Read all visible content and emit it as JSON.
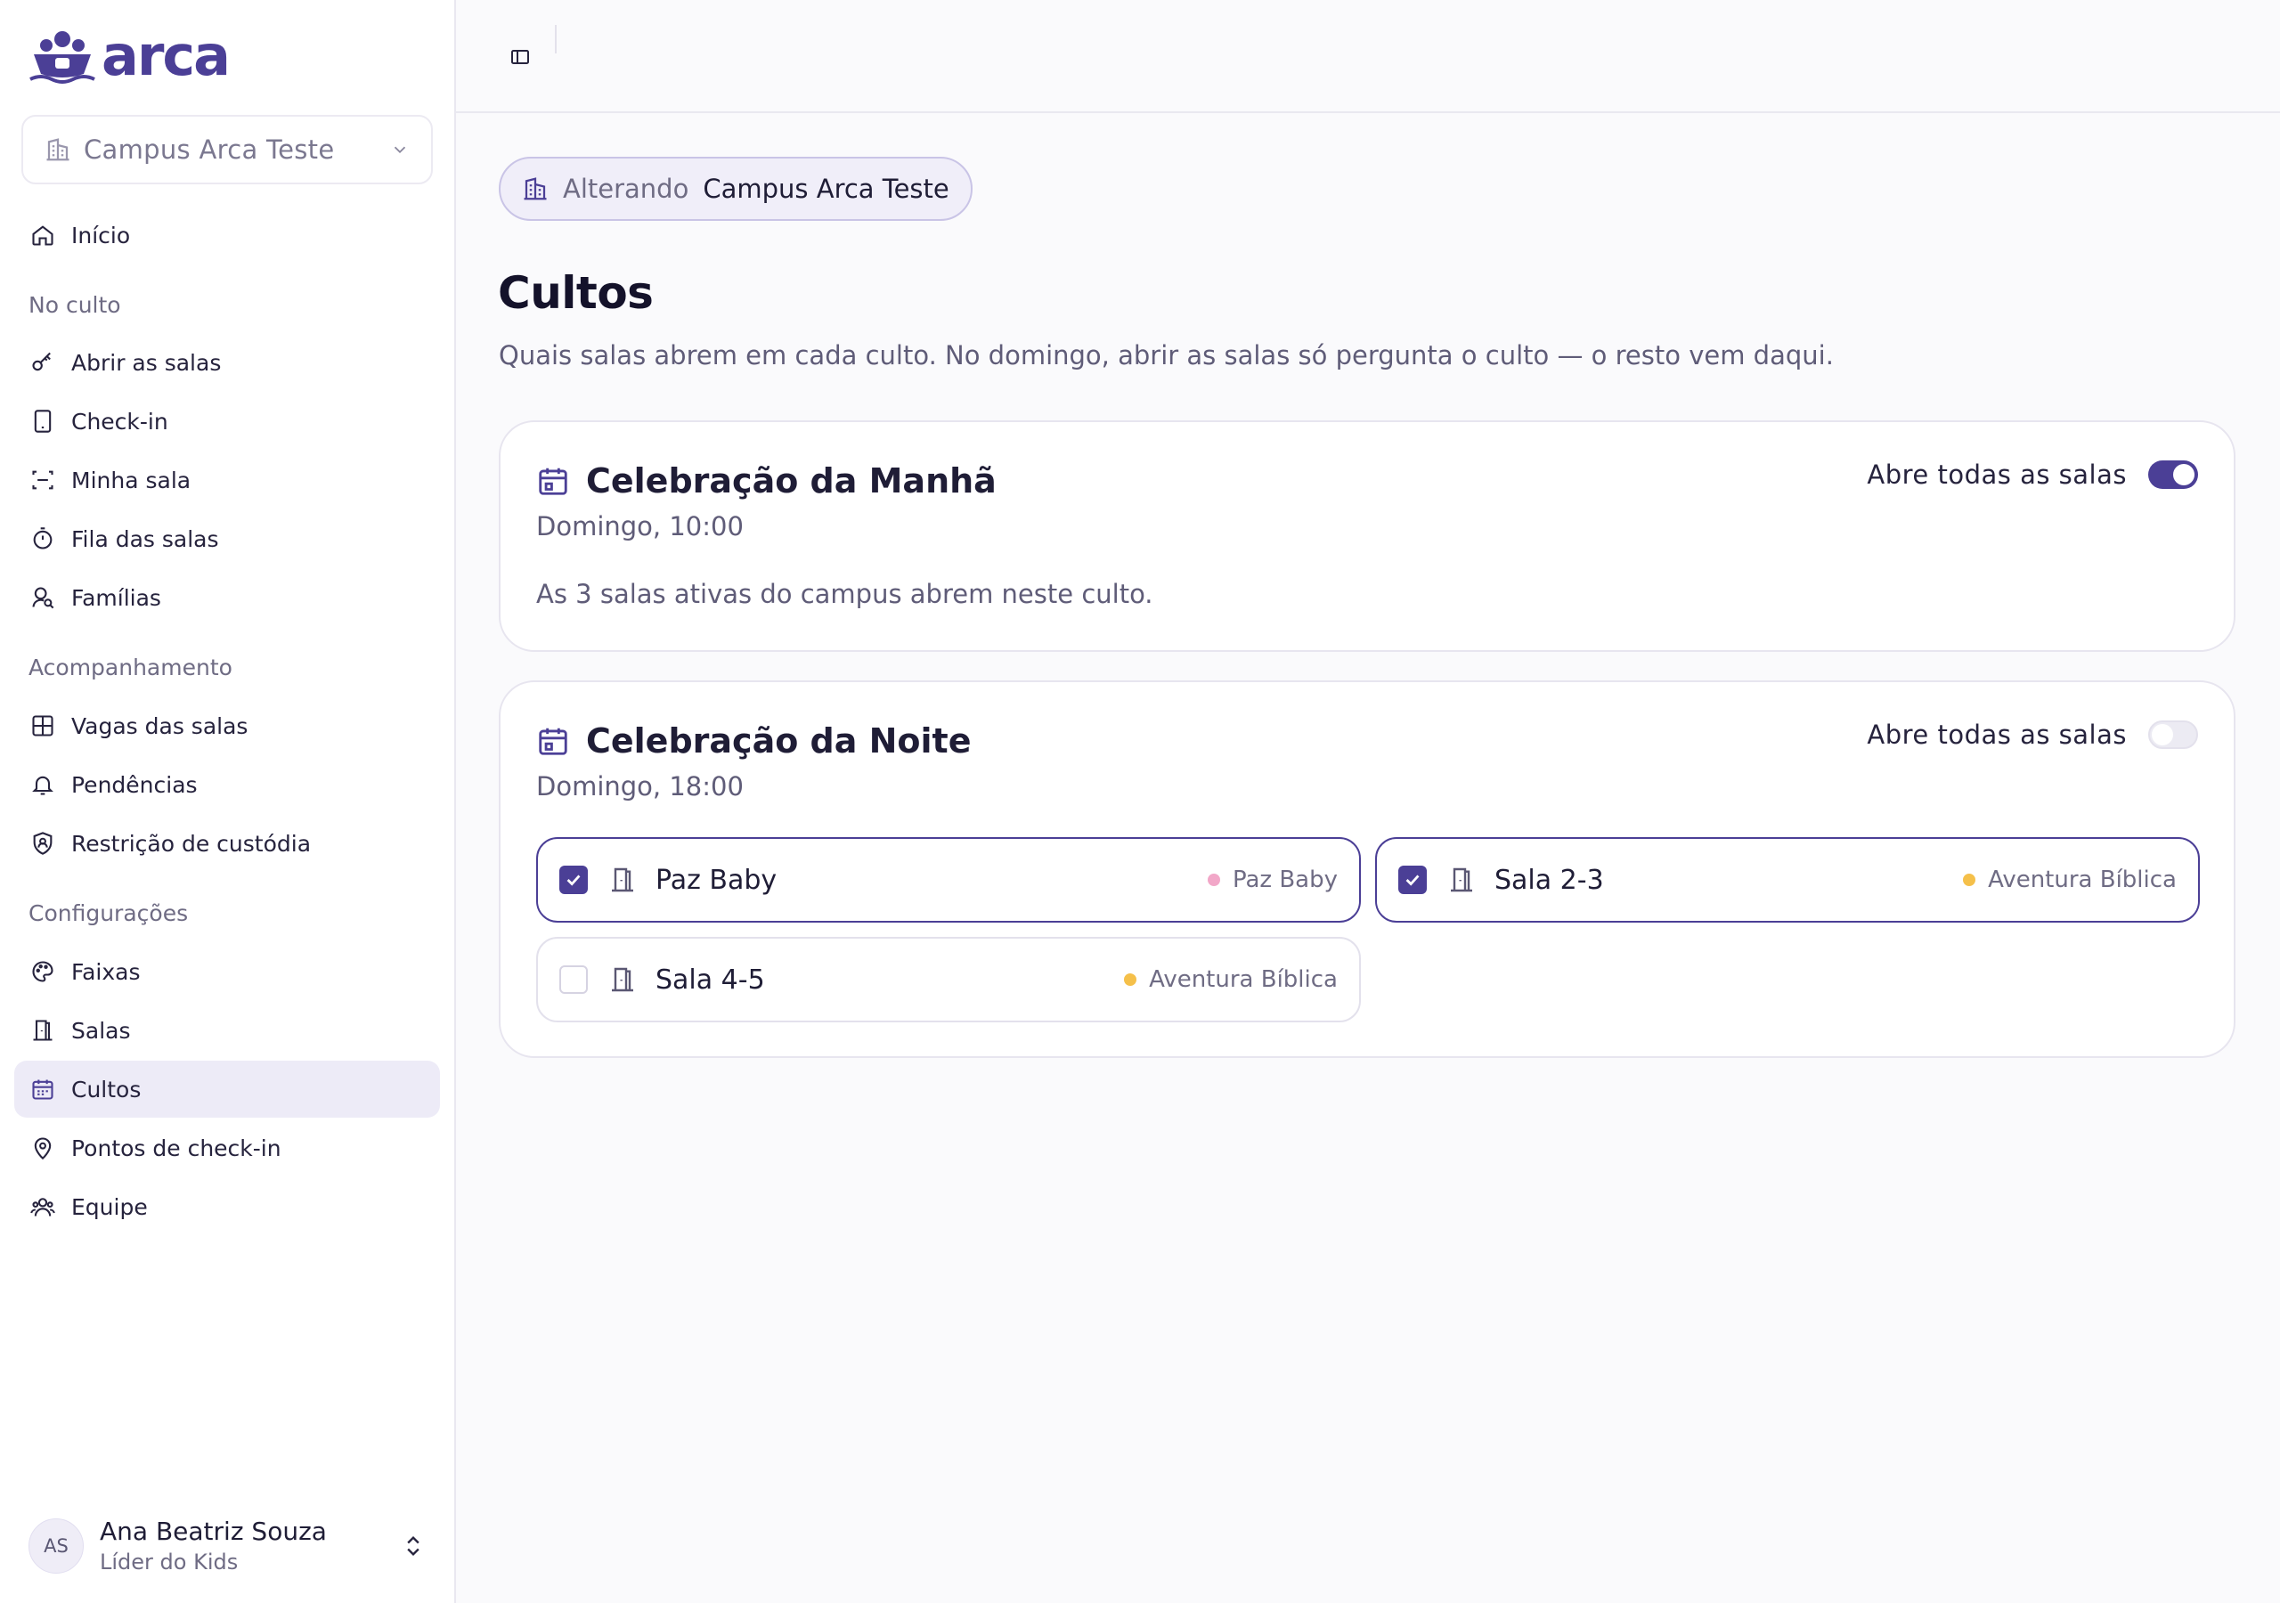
{
  "app": {
    "logo_text": "arca",
    "brand_color": "#4b3f96"
  },
  "sidebar": {
    "campus_select": "Campus Arca Teste",
    "home": "Início",
    "sections": [
      {
        "title": "No culto",
        "items": [
          "Abrir as salas",
          "Check-in",
          "Minha sala",
          "Fila das salas",
          "Famílias"
        ]
      },
      {
        "title": "Acompanhamento",
        "items": [
          "Vagas das salas",
          "Pendências",
          "Restrição de custódia"
        ]
      },
      {
        "title": "Configurações",
        "items": [
          "Faixas",
          "Salas",
          "Cultos",
          "Pontos de check-in",
          "Equipe"
        ]
      }
    ],
    "active_item": "Cultos",
    "user": {
      "initials": "AS",
      "name": "Ana Beatriz Souza",
      "role": "Líder do Kids"
    }
  },
  "main": {
    "chip": {
      "label": "Alterando",
      "value": "Campus Arca Teste"
    },
    "title": "Cultos",
    "description": "Quais salas abrem em cada culto. No domingo, abrir as salas só pergunta o culto — o resto vem daqui.",
    "services": [
      {
        "name": "Celebração da Manhã",
        "schedule": "Domingo, 10:00",
        "opens_all_label": "Abre todas as salas",
        "opens_all": true,
        "note": "As 3 salas ativas do campus abrem neste culto."
      },
      {
        "name": "Celebração da Noite",
        "schedule": "Domingo, 18:00",
        "opens_all_label": "Abre todas as salas",
        "opens_all": false,
        "rooms": [
          {
            "name": "Paz Baby",
            "checked": true,
            "tag": "Paz Baby",
            "tag_color": "#f2a7c8"
          },
          {
            "name": "Sala 2-3",
            "checked": true,
            "tag": "Aventura Bíblica",
            "tag_color": "#f5c04a"
          },
          {
            "name": "Sala 4-5",
            "checked": false,
            "tag": "Aventura Bíblica",
            "tag_color": "#f5c04a"
          }
        ]
      }
    ]
  }
}
